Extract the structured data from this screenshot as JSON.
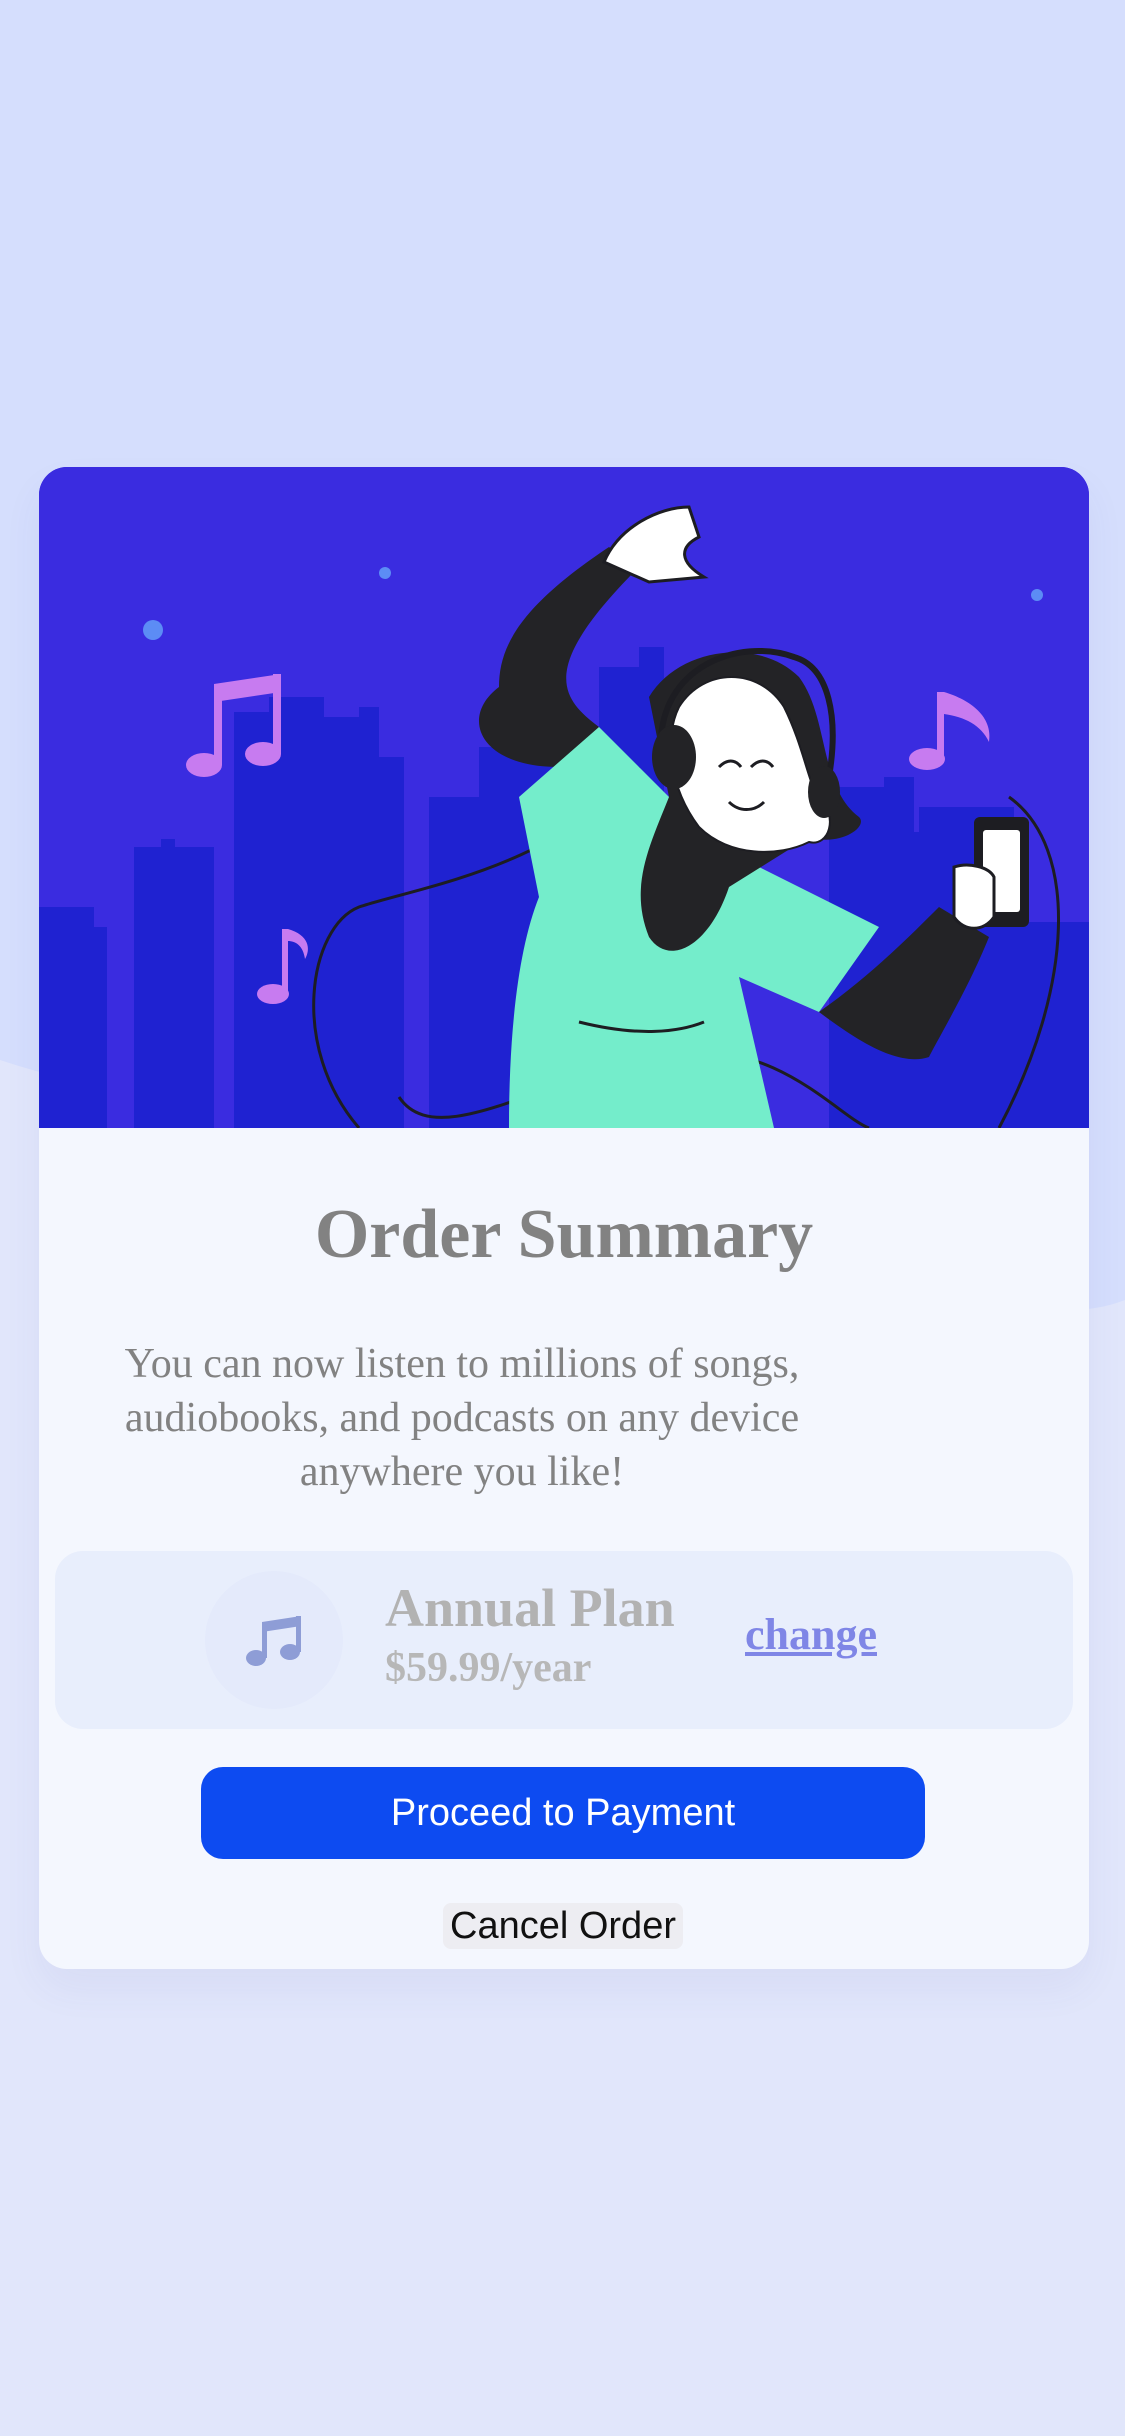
{
  "order": {
    "title": "Order Summary",
    "description": "You can now listen to millions of songs, audiobooks, and podcasts on any device anywhere you like!",
    "plan": {
      "icon": "music-note-icon",
      "name": "Annual Plan",
      "price": "$59.99/year",
      "change_label": "change"
    },
    "pay_label": "Proceed to Payment",
    "cancel_label": "Cancel Order"
  },
  "theme": {
    "page_background": "#e1e6fb",
    "hero_background": "#3a2ce0",
    "accent": "#0d4bf1",
    "link": "#7f86e6"
  }
}
